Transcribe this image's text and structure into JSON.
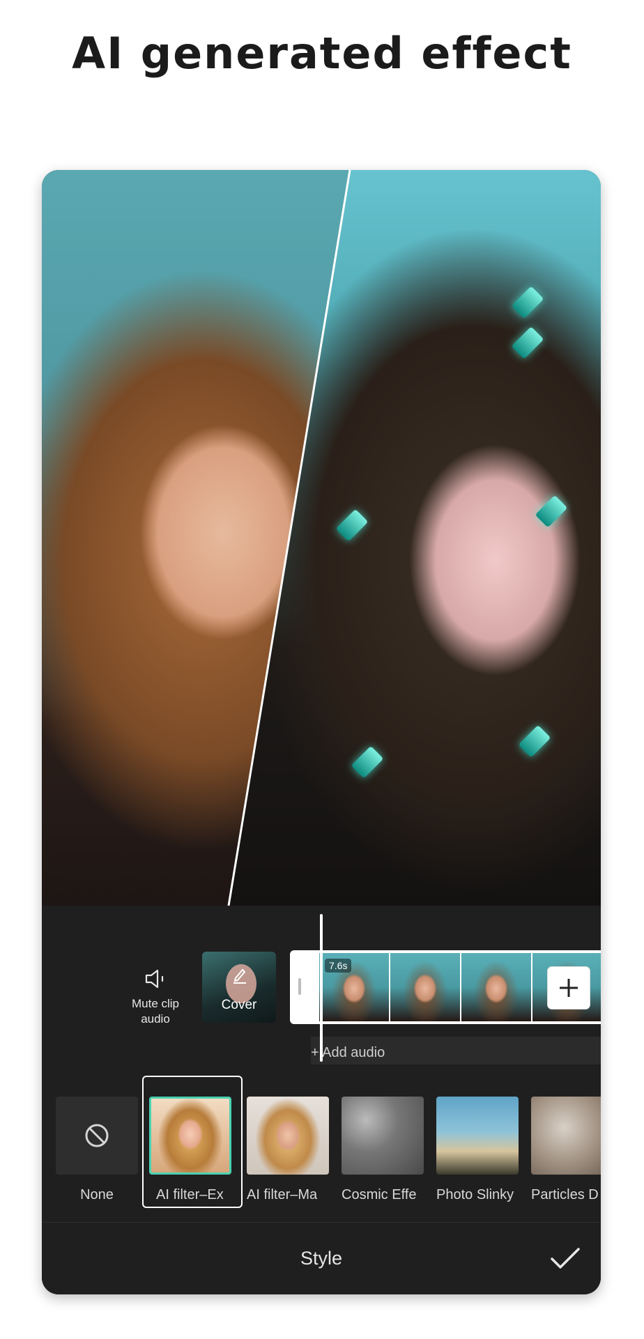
{
  "headline": "AI generated effect",
  "timeline": {
    "mute_label": "Mute clip audio",
    "cover_label": "Cover",
    "clip_duration": "7.6s",
    "add_audio_label": "+ Add audio"
  },
  "styles": {
    "items": [
      {
        "label": "None",
        "icon": "no-symbol-icon"
      },
      {
        "label": "AI filter–Ex",
        "selected": true
      },
      {
        "label": "AI filter–Ma"
      },
      {
        "label": "Cosmic Effe"
      },
      {
        "label": "Photo Slinky"
      },
      {
        "label": "Particles D"
      }
    ]
  },
  "bottom_bar": {
    "title": "Style",
    "confirm_icon": "checkmark-icon"
  },
  "colors": {
    "panel_bg": "#1f1f1f",
    "selected_accent": "#4ad2b2"
  }
}
